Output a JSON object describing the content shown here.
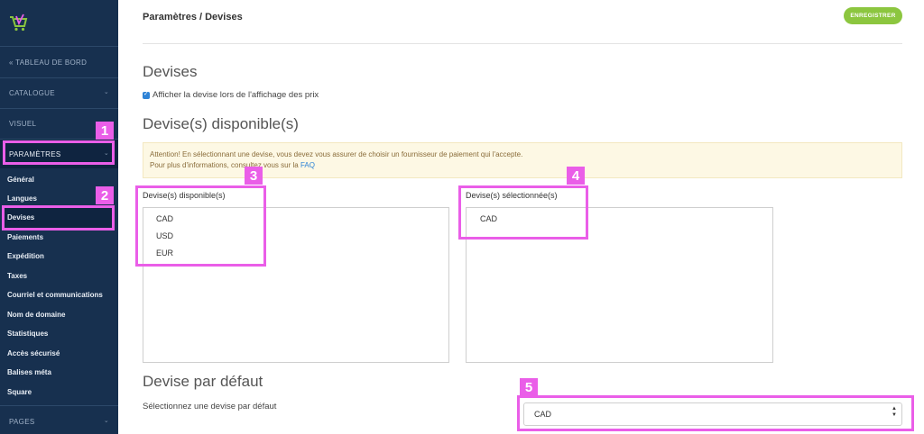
{
  "sidebar": {
    "dashboard": "« TABLEAU DE BORD",
    "catalogue": "CATALOGUE",
    "visuel": "VISUEL",
    "parametres": "PARAMÈTRES",
    "pages": "PAGES",
    "items": [
      "Général",
      "Langues",
      "Devises",
      "Paiements",
      "Expédition",
      "Taxes",
      "Courriel et communications",
      "Nom de domaine",
      "Statistiques",
      "Accès sécurisé",
      "Balises méta",
      "Square"
    ]
  },
  "header": {
    "breadcrumb": "Paramètres / Devises",
    "save_label": "ENREGISTRER"
  },
  "main": {
    "title": "Devises",
    "show_currency_label": "Afficher la devise lors de l'affichage des prix",
    "available_heading": "Devise(s) disponible(s)",
    "alert_line1": "Attention! En sélectionnant une devise, vous devez vous assurer de choisir un fournisseur de paiement qui l'accepte.",
    "alert_line2": "Pour plus d'informations, consultez vous sur la",
    "alert_link": "FAQ",
    "available_label": "Devise(s) disponible(s)",
    "available_options": [
      "CAD",
      "USD",
      "EUR"
    ],
    "selected_label": "Devise(s) sélectionnée(s)",
    "selected_options": [
      "CAD"
    ],
    "default_heading": "Devise par défaut",
    "default_help": "Sélectionnez une devise par défaut",
    "default_value": "CAD"
  },
  "annotations": [
    "1",
    "2",
    "3",
    "4",
    "5"
  ],
  "colors": {
    "sidebar_bg": "#17304f",
    "accent_green": "#8cc63f",
    "highlight": "#ea5ee8",
    "link": "#2e83d6"
  }
}
